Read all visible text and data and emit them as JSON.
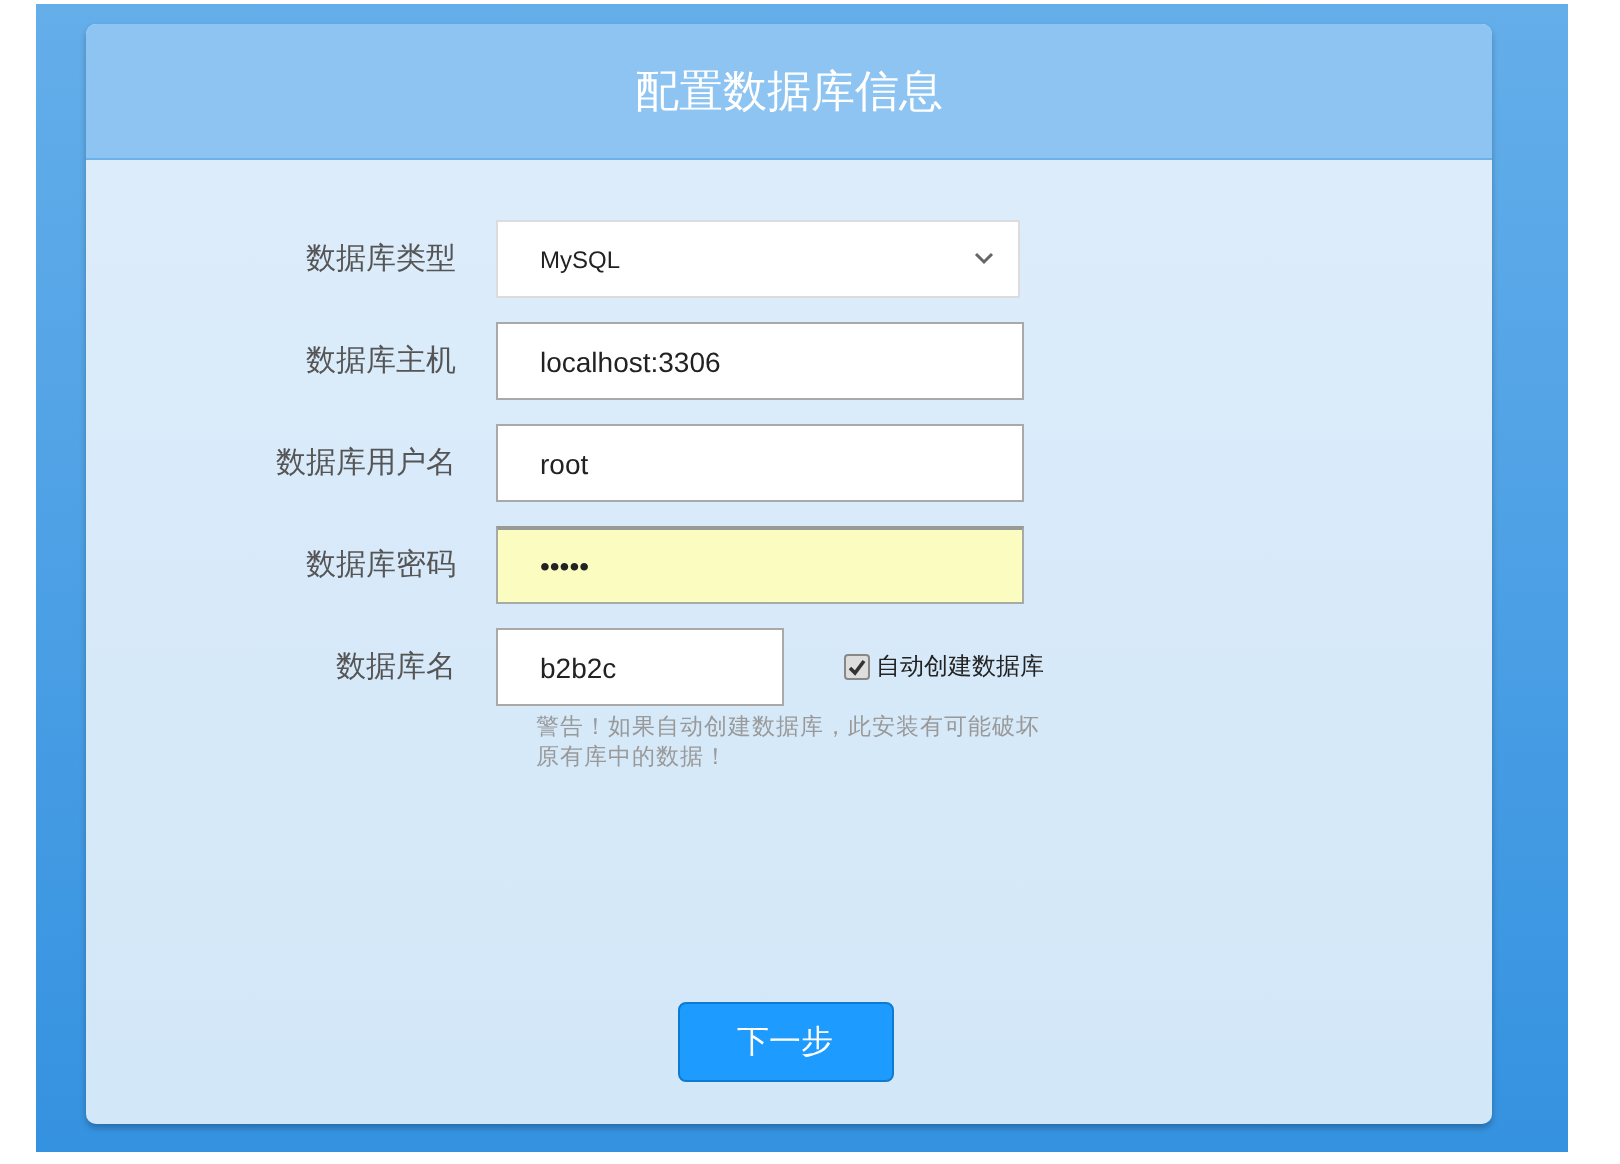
{
  "title": "配置数据库信息",
  "fields": [
    {
      "label": "数据库类型",
      "kind": "select",
      "value": "MySQL",
      "highlighted": false
    },
    {
      "label": "数据库主机",
      "kind": "text",
      "value": "localhost:3306",
      "highlighted": false
    },
    {
      "label": "数据库用户名",
      "kind": "text",
      "value": "root",
      "highlighted": false
    },
    {
      "label": "数据库密码",
      "kind": "password",
      "value": "•••••",
      "highlighted": true
    },
    {
      "label": "数据库名",
      "kind": "text",
      "value": "b2b2c",
      "highlighted": false,
      "option": {
        "label": "自动创建数据库",
        "checked": true
      },
      "warning": "警告！如果自动创建数据库，此安装有可能破坏原有库中的数据！"
    }
  ],
  "button": "下一步"
}
